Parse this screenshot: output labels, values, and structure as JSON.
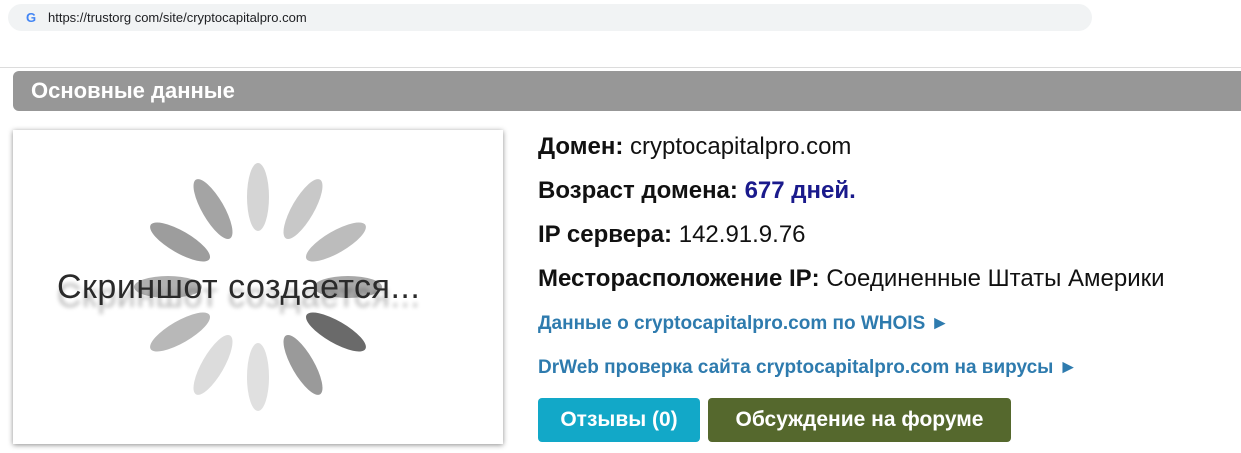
{
  "browser": {
    "url": "https://trustorg com/site/cryptocapitalpro.com",
    "site_icon": "google-g-icon",
    "site_icon_glyph": "G"
  },
  "section": {
    "title": "Основные данные"
  },
  "screenshot": {
    "placeholder_text": "Скриншот создается...",
    "spinner_icon": "loading-spinner-icon"
  },
  "info": {
    "domain_label": "Домен:",
    "domain_value": "cryptocapitalpro.com",
    "age_label": "Возраст домена:",
    "age_value": "677 дней.",
    "ip_label": "IP сервера:",
    "ip_value": "142.91.9.76",
    "location_label": "Месторасположение IP:",
    "location_value": "Соединенные Штаты Америки"
  },
  "links": {
    "whois": "Данные о cryptocapitalpro.com по WHOIS ►",
    "drweb": "DrWeb проверка сайта cryptocapitalpro.com на вирусы ►"
  },
  "buttons": {
    "reviews": "Отзывы (0)",
    "forum": "Обсуждение на форуме"
  },
  "colors": {
    "header_bg": "#979797",
    "link": "#2e7bae",
    "age_value": "#1a1a8c",
    "reviews_button": "#12a8c8",
    "forum_button": "#55682d"
  }
}
